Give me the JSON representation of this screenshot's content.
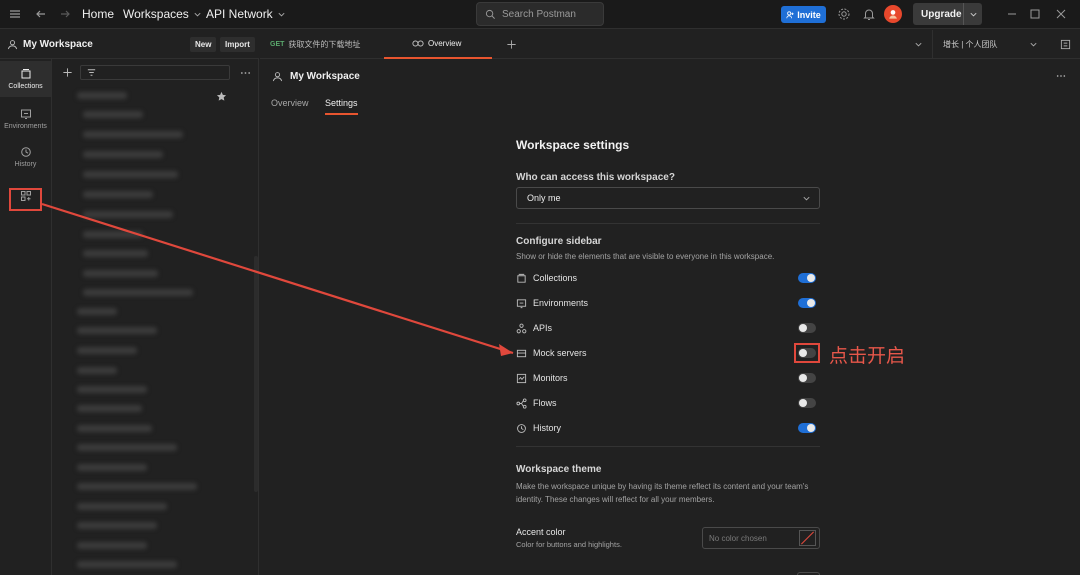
{
  "topbar": {
    "home": "Home",
    "workspaces": "Workspaces",
    "api_network": "API Network",
    "search_placeholder": "Search Postman",
    "invite": "Invite",
    "upgrade": "Upgrade"
  },
  "workspace": {
    "title": "My Workspace",
    "new_label": "New",
    "import_label": "Import"
  },
  "rail": {
    "items": [
      {
        "label": "Collections",
        "icon": "collections-icon"
      },
      {
        "label": "Environments",
        "icon": "environments-icon"
      },
      {
        "label": "History",
        "icon": "history-icon"
      }
    ]
  },
  "tabs": {
    "request_method": "GET",
    "request_name": "获取文件的下载地址",
    "overview": "Overview",
    "environment": "增长 | 个人团队"
  },
  "main": {
    "title": "My Workspace",
    "subtabs": [
      "Overview",
      "Settings"
    ]
  },
  "settings": {
    "heading": "Workspace settings",
    "access_label": "Who can access this workspace?",
    "access_value": "Only me",
    "sidebar_heading": "Configure sidebar",
    "sidebar_desc": "Show or hide the elements that are visible to everyone in this workspace.",
    "items": [
      {
        "label": "Collections",
        "enabled": true
      },
      {
        "label": "Environments",
        "enabled": true
      },
      {
        "label": "APIs",
        "enabled": false
      },
      {
        "label": "Mock servers",
        "enabled": false
      },
      {
        "label": "Monitors",
        "enabled": false
      },
      {
        "label": "Flows",
        "enabled": false
      },
      {
        "label": "History",
        "enabled": true
      }
    ],
    "theme_heading": "Workspace theme",
    "theme_desc": "Make the workspace unique by having its theme reflect its content and your team's identity. These changes will reflect for all your members.",
    "accent_label": "Accent color",
    "accent_desc": "Color for buttons and highlights.",
    "accent_placeholder": "No color chosen"
  },
  "annotation": {
    "text": "点击开启",
    "color": "#e0483c"
  }
}
